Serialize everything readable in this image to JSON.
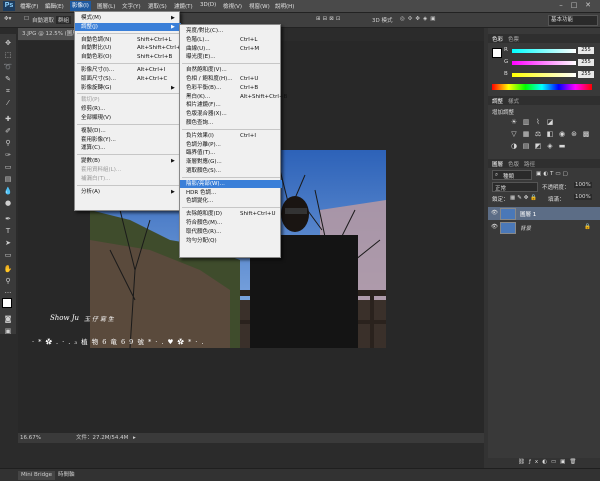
{
  "colors": {
    "menu_highlight": "#3a7fd8",
    "menubar_active": "#1f5aa0",
    "sky": "#3c6fbf",
    "panel_bg": "#393939"
  },
  "menubar": {
    "logo": "Ps",
    "items": [
      "檔案(F)",
      "編輯(E)",
      "影像(I)",
      "圖層(L)",
      "文字(Y)",
      "選取(S)",
      "濾鏡(T)",
      "3D(D)",
      "檢視(V)",
      "視窗(W)",
      "說明(H)"
    ],
    "active_index": 2
  },
  "options": {
    "auto_select": "自動選取",
    "group": "群組",
    "mode_3d": "3D 模式",
    "workspace": "基本功能"
  },
  "document": {
    "tab": "3.JPG @ 12.5% (圖層 1, RGB/8)",
    "zoom": "16.67%",
    "doc_size": "文件：27.2M/54.4M"
  },
  "image_menu": {
    "items": [
      {
        "label": "模式(M)",
        "shortcut": "",
        "submenu": true,
        "disabled": false
      },
      {
        "label": "調整(J)",
        "shortcut": "",
        "submenu": true,
        "disabled": false,
        "highlighted": true
      },
      {
        "label": "自動色調(N)",
        "shortcut": "Shift+Ctrl+L",
        "disabled": false
      },
      {
        "label": "自動對比(U)",
        "shortcut": "Alt+Shift+Ctrl+L",
        "disabled": false
      },
      {
        "label": "自動色彩(O)",
        "shortcut": "Shift+Ctrl+B",
        "disabled": false
      },
      {
        "label": "影像尺寸(I)...",
        "shortcut": "Alt+Ctrl+I",
        "disabled": false
      },
      {
        "label": "版面尺寸(S)...",
        "shortcut": "Alt+Ctrl+C",
        "disabled": false
      },
      {
        "label": "影像旋轉(G)",
        "shortcut": "",
        "submenu": true,
        "disabled": false
      },
      {
        "label": "裁切(P)",
        "shortcut": "",
        "disabled": true
      },
      {
        "label": "修剪(R)...",
        "shortcut": "",
        "disabled": false
      },
      {
        "label": "全部顯現(V)",
        "shortcut": "",
        "disabled": false
      },
      {
        "label": "複製(D)...",
        "shortcut": "",
        "disabled": false
      },
      {
        "label": "套用影像(Y)...",
        "shortcut": "",
        "disabled": false
      },
      {
        "label": "運算(C)...",
        "shortcut": "",
        "disabled": false
      },
      {
        "label": "變數(B)",
        "shortcut": "",
        "submenu": true,
        "disabled": false
      },
      {
        "label": "套用資料組(L)...",
        "shortcut": "",
        "disabled": true
      },
      {
        "label": "補漏白(T)...",
        "shortcut": "",
        "disabled": true
      },
      {
        "label": "分析(A)",
        "shortcut": "",
        "submenu": true,
        "disabled": false
      }
    ]
  },
  "adjust_menu": {
    "items": [
      {
        "label": "亮度/對比(C)...",
        "shortcut": ""
      },
      {
        "label": "色階(L)...",
        "shortcut": "Ctrl+L"
      },
      {
        "label": "曲線(U)...",
        "shortcut": "Ctrl+M"
      },
      {
        "label": "曝光度(E)...",
        "shortcut": ""
      },
      {
        "label": "自然飽和度(V)...",
        "shortcut": ""
      },
      {
        "label": "色相 / 飽和度(H)...",
        "shortcut": "Ctrl+U"
      },
      {
        "label": "色彩平衡(B)...",
        "shortcut": "Ctrl+B"
      },
      {
        "label": "黑白(K)...",
        "shortcut": "Alt+Shift+Ctrl+B"
      },
      {
        "label": "相片濾鏡(F)...",
        "shortcut": ""
      },
      {
        "label": "色版混合器(X)...",
        "shortcut": ""
      },
      {
        "label": "顏色查詢...",
        "shortcut": ""
      },
      {
        "label": "負片效果(I)",
        "shortcut": "Ctrl+I"
      },
      {
        "label": "色調分離(P)...",
        "shortcut": ""
      },
      {
        "label": "臨界值(T)...",
        "shortcut": ""
      },
      {
        "label": "漸層對應(G)...",
        "shortcut": ""
      },
      {
        "label": "選取顏色(S)...",
        "shortcut": ""
      },
      {
        "label": "陰影/亮部(W)...",
        "shortcut": "",
        "highlighted": true
      },
      {
        "label": "HDR 色調...",
        "shortcut": ""
      },
      {
        "label": "色調變化...",
        "shortcut": ""
      },
      {
        "label": "去除飽和度(D)",
        "shortcut": "Shift+Ctrl+U"
      },
      {
        "label": "符合顏色(M)...",
        "shortcut": ""
      },
      {
        "label": "取代顏色(R)...",
        "shortcut": ""
      },
      {
        "label": "均勻分配(Q)",
        "shortcut": ""
      }
    ]
  },
  "color_panel": {
    "tabs": [
      "色彩",
      "色票"
    ],
    "r": "255",
    "g": "255",
    "b": "255",
    "labels": [
      "R",
      "G",
      "B"
    ]
  },
  "adjust_panel": {
    "tabs": [
      "調整",
      "樣式"
    ],
    "title": "增加調整"
  },
  "layers_panel": {
    "tabs": [
      "圖層",
      "色版",
      "路徑"
    ],
    "kind": "種類",
    "blend": "正常",
    "opacity_label": "不透明度：",
    "opacity": "100%",
    "lock_label": "鎖定：",
    "fill_label": "填滿：",
    "fill": "100%",
    "layers": [
      {
        "name": "圖層 1",
        "selected": true
      },
      {
        "name": "背景",
        "selected": false
      }
    ]
  },
  "bottom_tabs": [
    "Mini Bridge",
    "時間軸"
  ],
  "photo": {
    "watermark_name": "Show Ju",
    "watermark_script": "玉 仔 寫 生",
    "watermark_line": "· * ✿ . · . ₃ 植 物 6 竜 6 9 號 * · . ♥ ✿ * · ."
  }
}
